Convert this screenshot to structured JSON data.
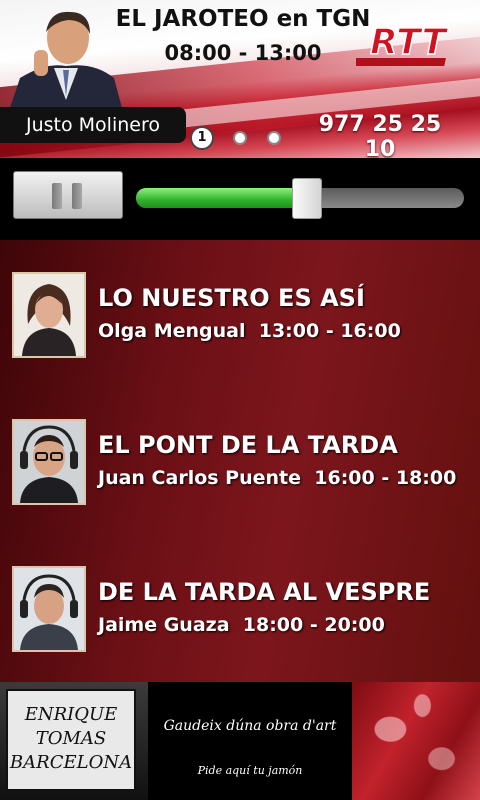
{
  "header": {
    "title": "EL JAROTEO en TGN",
    "time": "08:00 - 13:00",
    "presenter": "Justo Molinero",
    "phone": "977 25 25 10",
    "logo_text": "RTT",
    "pager": {
      "current": "1",
      "total_pages": 3
    }
  },
  "player": {
    "state": "playing",
    "control_icon": "pause-icon",
    "volume": 0.52
  },
  "schedule": [
    {
      "title": "LO NUESTRO ES ASÍ",
      "host": "Olga Mengual",
      "time": "13:00 - 16:00"
    },
    {
      "title": "EL PONT DE LA TARDA",
      "host": "Juan Carlos Puente",
      "time": "16:00 - 18:00"
    },
    {
      "title": "DE LA TARDA AL VESPRE",
      "host": "Jaime Guaza",
      "time": "18:00 - 20:00"
    }
  ],
  "ad": {
    "brand_line1": "ENRIQUE",
    "brand_line2": "TOMAS",
    "brand_line3": "BARCELONA",
    "slogan": "Gaudeix dúna obra d'art",
    "cta": "Pide aquí tu jamón"
  },
  "colors": {
    "accent_red": "#a40f1e",
    "progress_green": "#2fb32a",
    "schedule_bg": "#6c1016"
  }
}
